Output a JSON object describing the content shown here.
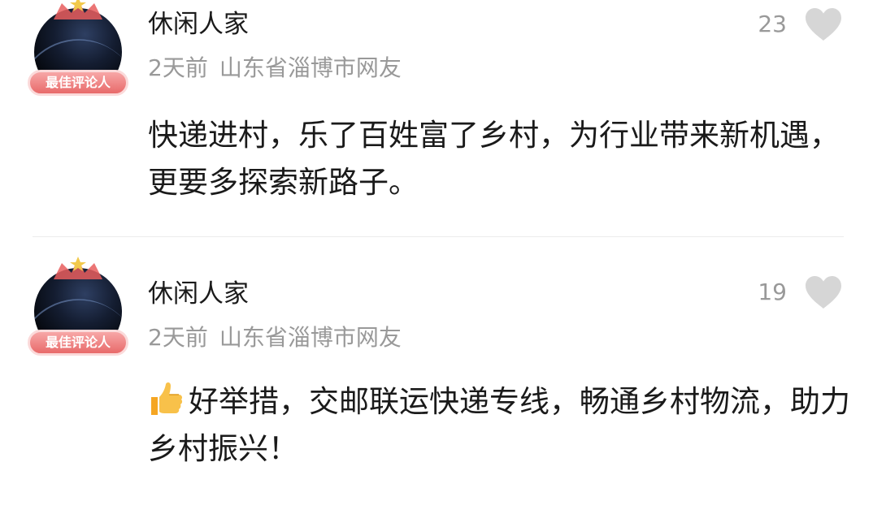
{
  "comments": [
    {
      "username": "休闲人家",
      "time": "2天前",
      "location": "山东省淄博市网友",
      "badge": "最佳评论人",
      "likes": "23",
      "text": "快递进村，乐了百姓富了乡村，为行业带来新机遇，更要多探索新路子。",
      "has_thumb_emoji": false,
      "liked": false
    },
    {
      "username": "休闲人家",
      "time": "2天前",
      "location": "山东省淄博市网友",
      "badge": "最佳评论人",
      "likes": "19",
      "text": "好举措，交邮联运快递专线，畅通乡村物流，助力乡村振兴！",
      "has_thumb_emoji": true,
      "liked": false
    }
  ],
  "icons": {
    "avatar": "avatar-icon",
    "crown": "crown-icon",
    "like": "heart-icon",
    "emoji": "thumbs-up-icon"
  },
  "colors": {
    "badge": "#e86a6a",
    "meta_text": "#999999",
    "heart": "#d6d6d6",
    "crown_gold": "#f2c94c"
  }
}
